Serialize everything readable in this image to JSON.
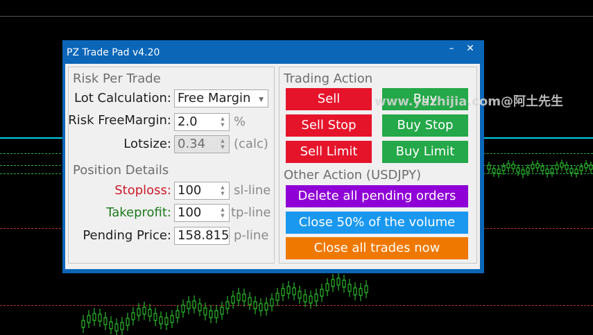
{
  "window": {
    "title": "PZ Trade Pad v4.20",
    "minimize_glyph": "–",
    "close_glyph": "✕"
  },
  "risk": {
    "header": "Risk Per Trade",
    "lot_calc_label": "Lot Calculation:",
    "lot_calc_value": "Free Margin",
    "risk_label": "Risk FreeMargin:",
    "risk_value": "2.0",
    "risk_unit": "%",
    "lotsize_label": "Lotsize:",
    "lotsize_value": "0.34",
    "lotsize_unit": "(calc)"
  },
  "position": {
    "header": "Position Details",
    "stoploss_label": "Stoploss:",
    "stoploss_value": "100",
    "stoploss_unit": "sl-line",
    "takeprofit_label": "Takeprofit:",
    "takeprofit_value": "100",
    "takeprofit_unit": "tp-line",
    "pending_label": "Pending Price:",
    "pending_value": "158.815",
    "pending_unit": "p-line"
  },
  "trading": {
    "header": "Trading Action",
    "sell": "Sell",
    "buy": "Buy",
    "sell_stop": "Sell Stop",
    "buy_stop": "Buy Stop",
    "sell_limit": "Sell Limit",
    "buy_limit": "Buy Limit"
  },
  "other": {
    "header": "Other Action (USDJPY)",
    "delete_pending": "Delete all pending orders",
    "close_half": "Close 50% of the volume",
    "close_all": "Close all trades now"
  },
  "watermark": "www.yazhijia.com@阿土先生",
  "colors": {
    "window_frame": "#0b66b8",
    "stoploss_label": "#cc1a2b",
    "takeprofit_label": "#1d7a1d",
    "sell": "#e5142b",
    "buy": "#24a849",
    "delete": "#8f00d6",
    "close_half": "#1a98f0",
    "close_all": "#ef7800"
  },
  "icons": {
    "spinner": "updown-spinner-icon",
    "dropdown": "dropdown-arrow-icon"
  }
}
